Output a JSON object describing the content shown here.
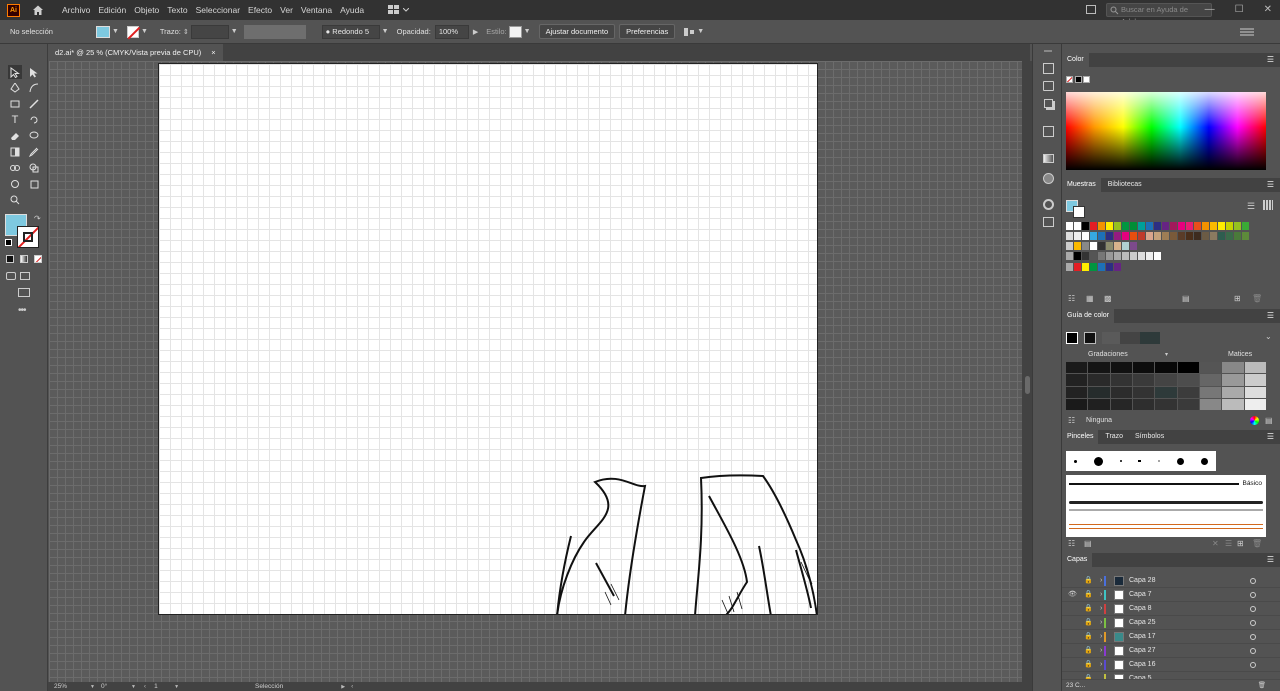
{
  "menubar": {
    "logo": "Ai",
    "items": [
      "Archivo",
      "Edición",
      "Objeto",
      "Texto",
      "Seleccionar",
      "Efecto",
      "Ver",
      "Ventana",
      "Ayuda"
    ],
    "help_placeholder": "Buscar en Ayuda de Adobe"
  },
  "control": {
    "selection": "No selección",
    "stroke_label": "Trazo:",
    "brush": "Redondo 5 ...",
    "opacity_label": "Opacidad:",
    "opacity": "100%",
    "style_label": "Estilo:",
    "adjust_button": "Ajustar documento",
    "prefs_button": "Preferencias",
    "fill_color": "#7ec9e0"
  },
  "document": {
    "tab_title": "d2.ai* @ 25 % (CMYK/Vista previa de CPU)",
    "close": "×"
  },
  "status": {
    "zoom": "25%",
    "rotation": "0°",
    "artboard": "1",
    "tool": "Selección"
  },
  "panels": {
    "color": {
      "title": "Color"
    },
    "swatches": {
      "tab1": "Muestras",
      "tab2": "Bibliotecas"
    },
    "guide": {
      "title": "Guía de color",
      "gradations": "Gradaciones",
      "matices": "Matices",
      "none": "Ninguna"
    },
    "brushes": {
      "tab1": "Pinceles",
      "tab2": "Trazo",
      "tab3": "Símbolos",
      "basic": "Básico"
    },
    "layers": {
      "title": "Capas",
      "items": [
        {
          "name": "Capa 28",
          "color": "#4a6fdc"
        },
        {
          "name": "Capa 7",
          "color": "#3fc4c4"
        },
        {
          "name": "Capa 8",
          "color": "#d04040"
        },
        {
          "name": "Capa 25",
          "color": "#7cc043"
        },
        {
          "name": "Capa 17",
          "color": "#e09a2a"
        },
        {
          "name": "Capa 27",
          "color": "#8a3ad0"
        },
        {
          "name": "Capa 16",
          "color": "#5a4ad0"
        },
        {
          "name": "Capa 5",
          "color": "#c0c040"
        }
      ],
      "count": "23 C..."
    }
  }
}
